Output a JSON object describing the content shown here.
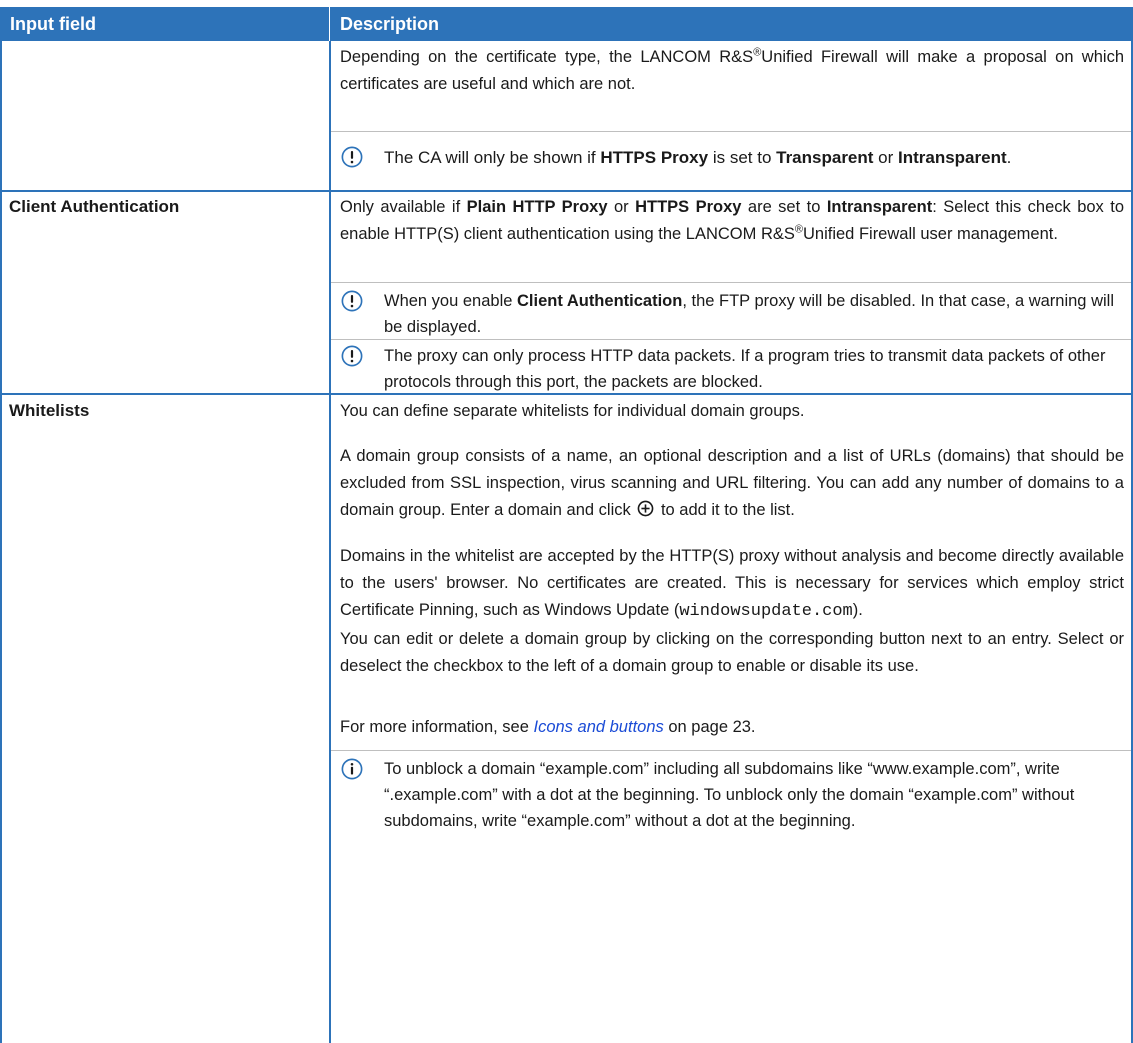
{
  "header": {
    "col1": "Input field",
    "col2": "Description"
  },
  "row_ca": {
    "p1_a": "Depending on the certificate type, the LANCOM R&S",
    "p1_reg": "®",
    "p1_b": "Unified Firewall will make a proposal on which certificates are useful and which are not.",
    "note_a": "The CA will only be shown if ",
    "note_b1": "HTTPS Proxy",
    "note_c": " is set to ",
    "note_b2": "Transparent",
    "note_d": " or ",
    "note_b3": "Intransparent",
    "note_e": "."
  },
  "row_client": {
    "label": "Client Authentication",
    "p1_a": "Only available if ",
    "p1_b1": "Plain HTTP Proxy",
    "p1_c": " or ",
    "p1_b2": "HTTPS Proxy",
    "p1_d": " are set to ",
    "p1_b3": "Intransparent",
    "p1_e": ": Select this check box to enable HTTP(S) client authentication using the LANCOM R&S",
    "p1_reg": "®",
    "p1_f": "Unified Firewall user management.",
    "note1_a": "When you enable ",
    "note1_b": "Client Authentication",
    "note1_c": ", the FTP proxy will be disabled. In that case, a warning will be displayed.",
    "note2": "The proxy can only process HTTP data packets. If a program tries to transmit data packets of other protocols through this port, the packets are blocked."
  },
  "row_whitelists": {
    "label": "Whitelists",
    "p1": "You can define separate whitelists for individual domain groups.",
    "p2_a": "A domain group consists of a name, an optional description and a list of URLs (domains) that should be excluded from SSL inspection, virus scanning and URL filtering. You can add any number of domains to a domain group. Enter a domain and click",
    "p2_b": "to add it to the list.",
    "p3_a": "Domains in the whitelist are accepted by the HTTP(S) proxy without analysis and become directly available to the users' browser. No certificates are created. This is necessary for services which employ strict Certificate Pinning, such as Windows Update (",
    "p3_code": "windowsupdate.com",
    "p3_b": ").",
    "p4": "You can edit or delete a domain group by clicking on the corresponding button next to an entry. Select or deselect the checkbox to the left of a domain group to enable or disable its use.",
    "p5_a": "For more information, see ",
    "p5_link": "Icons and buttons",
    "p5_b": " on page 23.",
    "info": "To unblock a domain “example.com” including all subdomains like “www.example.com”, write “.example.com” with a dot at the beginning. To unblock only the domain “example.com” without subdomains, write “example.com” without a dot at the beginning."
  },
  "icons": {
    "warning": "exclamation-circle-icon",
    "info": "info-circle-icon",
    "add": "plus-circle-icon"
  },
  "colors": {
    "header_bg": "#2d73b9",
    "grid": "#2d73b9",
    "link": "#1a4bd6"
  }
}
